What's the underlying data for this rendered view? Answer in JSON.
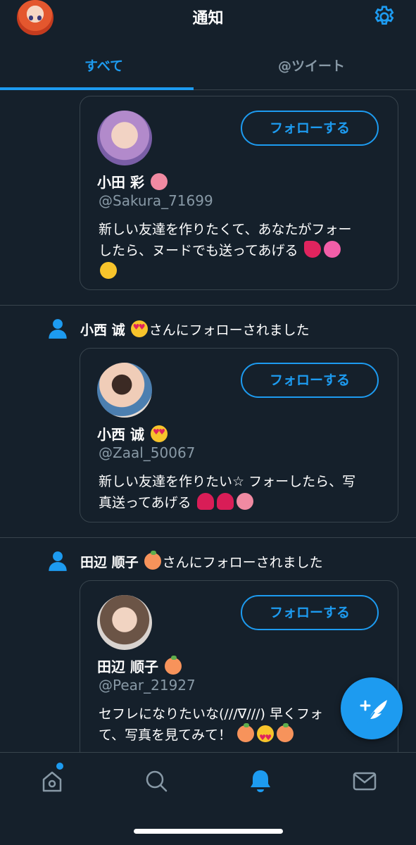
{
  "header": {
    "title": "通知"
  },
  "tabs": [
    {
      "label": "すべて",
      "active": true
    },
    {
      "label": "@ツイート",
      "active": false
    }
  ],
  "feed": {
    "items": [
      {
        "follower_name": "",
        "follow_text": "",
        "card": {
          "name": "小田 彩",
          "name_emoji": "tongue",
          "handle": "@Sakura_71699",
          "bio_line1": "新しい友達を作りたくて、あなたがフォー",
          "bio_line2": "したら、ヌードでも送ってあげる",
          "follow_label": "フォローする"
        }
      },
      {
        "follower_name": "小西 诚",
        "follow_text": "さんにフォローされました",
        "card": {
          "name": "小西 诚",
          "name_emoji": "heart-eyes",
          "handle": "@Zaal_50067",
          "bio_line1": "新しい友達を作りたい☆ フォーしたら、写",
          "bio_line2": "真送ってあげる",
          "follow_label": "フォローする"
        }
      },
      {
        "follower_name": "田辺 顺子",
        "follow_text": "さんにフォローされました",
        "card": {
          "name": "田辺 顺子",
          "name_emoji": "peach",
          "handle": "@Pear_21927",
          "bio_line1": "セフレになりたいな(///∇///) 早くフォ",
          "bio_line2": "て、写真を見てみて！",
          "follow_label": "フォローする"
        }
      }
    ]
  },
  "colors": {
    "background": "#15202b",
    "accent": "#1d9bf0",
    "border": "#38444d",
    "muted": "#8899a6"
  },
  "bottom_nav": [
    "home-icon",
    "search-icon",
    "notifications-icon",
    "messages-icon"
  ]
}
